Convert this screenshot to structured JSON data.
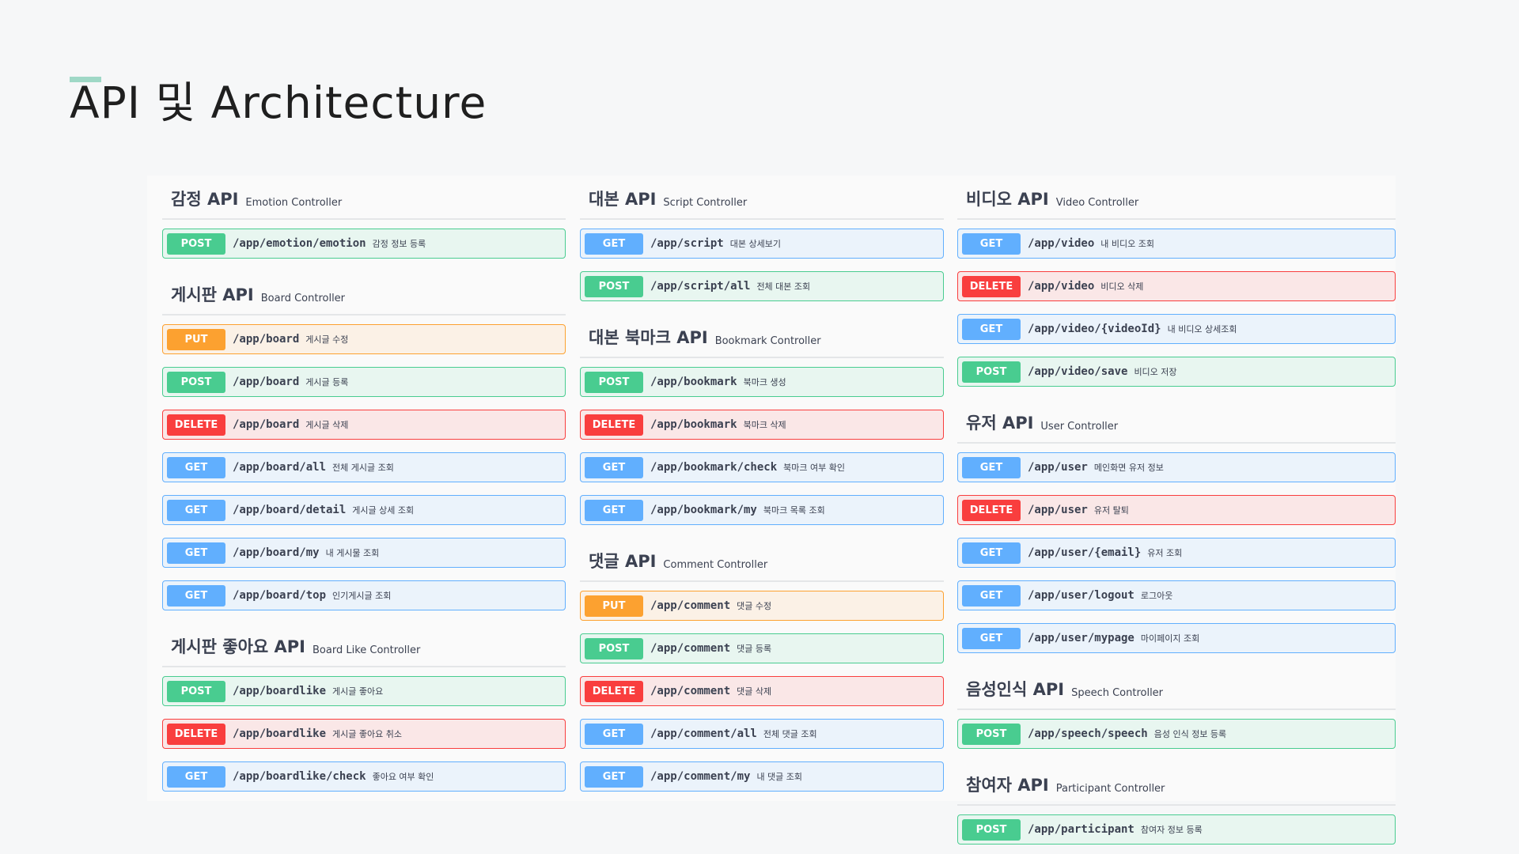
{
  "page": {
    "title": "API 및 Architecture"
  },
  "columns": [
    {
      "groups": [
        {
          "title": "감정 API",
          "subtitle": "Emotion Controller",
          "ops": [
            {
              "method": "POST",
              "path": "/app/emotion/emotion",
              "desc": "감정 정보 등록"
            }
          ]
        },
        {
          "title": "게시판 API",
          "subtitle": "Board Controller",
          "ops": [
            {
              "method": "PUT",
              "path": "/app/board",
              "desc": "게시글 수정"
            },
            {
              "method": "POST",
              "path": "/app/board",
              "desc": "게시글 등록"
            },
            {
              "method": "DELETE",
              "path": "/app/board",
              "desc": "게시글 삭제"
            },
            {
              "method": "GET",
              "path": "/app/board/all",
              "desc": "전체 게시글 조회"
            },
            {
              "method": "GET",
              "path": "/app/board/detail",
              "desc": "게시글 상세 조회"
            },
            {
              "method": "GET",
              "path": "/app/board/my",
              "desc": "내 게시물 조회"
            },
            {
              "method": "GET",
              "path": "/app/board/top",
              "desc": "인기게시글 조회"
            }
          ]
        },
        {
          "title": "게시판 좋아요 API",
          "subtitle": "Board Like Controller",
          "ops": [
            {
              "method": "POST",
              "path": "/app/boardlike",
              "desc": "게시글 좋아요"
            },
            {
              "method": "DELETE",
              "path": "/app/boardlike",
              "desc": "게시글 좋아요 취소"
            },
            {
              "method": "GET",
              "path": "/app/boardlike/check",
              "desc": "좋아요 여부 확인"
            }
          ]
        }
      ]
    },
    {
      "groups": [
        {
          "title": "대본 API",
          "subtitle": "Script Controller",
          "ops": [
            {
              "method": "GET",
              "path": "/app/script",
              "desc": "대본 상세보기"
            },
            {
              "method": "POST",
              "path": "/app/script/all",
              "desc": "전체 대본 조회"
            }
          ]
        },
        {
          "title": "대본 북마크 API",
          "subtitle": "Bookmark Controller",
          "ops": [
            {
              "method": "POST",
              "path": "/app/bookmark",
              "desc": "북마크 생성"
            },
            {
              "method": "DELETE",
              "path": "/app/bookmark",
              "desc": "북마크 삭제"
            },
            {
              "method": "GET",
              "path": "/app/bookmark/check",
              "desc": "북마크 여부 확인"
            },
            {
              "method": "GET",
              "path": "/app/bookmark/my",
              "desc": "북마크 목록 조회"
            }
          ]
        },
        {
          "title": "댓글 API",
          "subtitle": "Comment Controller",
          "ops": [
            {
              "method": "PUT",
              "path": "/app/comment",
              "desc": "댓글 수정"
            },
            {
              "method": "POST",
              "path": "/app/comment",
              "desc": "댓글 등록"
            },
            {
              "method": "DELETE",
              "path": "/app/comment",
              "desc": "댓글 삭제"
            },
            {
              "method": "GET",
              "path": "/app/comment/all",
              "desc": "전체 댓글 조회"
            },
            {
              "method": "GET",
              "path": "/app/comment/my",
              "desc": "내 댓글 조회"
            }
          ]
        }
      ]
    },
    {
      "groups": [
        {
          "title": "비디오 API",
          "subtitle": "Video Controller",
          "ops": [
            {
              "method": "GET",
              "path": "/app/video",
              "desc": "내 비디오 조회"
            },
            {
              "method": "DELETE",
              "path": "/app/video",
              "desc": "비디오 삭제"
            },
            {
              "method": "GET",
              "path": "/app/video/{videoId}",
              "desc": "내 비디오 상세조회"
            },
            {
              "method": "POST",
              "path": "/app/video/save",
              "desc": "비디오 저장"
            }
          ]
        },
        {
          "title": "유저 API",
          "subtitle": "User Controller",
          "ops": [
            {
              "method": "GET",
              "path": "/app/user",
              "desc": "메인화면 유저 정보"
            },
            {
              "method": "DELETE",
              "path": "/app/user",
              "desc": "유저 탈퇴"
            },
            {
              "method": "GET",
              "path": "/app/user/{email}",
              "desc": "유저 조회"
            },
            {
              "method": "GET",
              "path": "/app/user/logout",
              "desc": "로그아웃"
            },
            {
              "method": "GET",
              "path": "/app/user/mypage",
              "desc": "마이페이지 조회"
            }
          ]
        },
        {
          "title": "음성인식 API",
          "subtitle": "Speech Controller",
          "ops": [
            {
              "method": "POST",
              "path": "/app/speech/speech",
              "desc": "음성 인식 정보 등록"
            }
          ]
        },
        {
          "title": "참여자 API",
          "subtitle": "Participant Controller",
          "ops": [
            {
              "method": "POST",
              "path": "/app/participant",
              "desc": "참여자 정보 등록"
            }
          ]
        }
      ]
    }
  ]
}
